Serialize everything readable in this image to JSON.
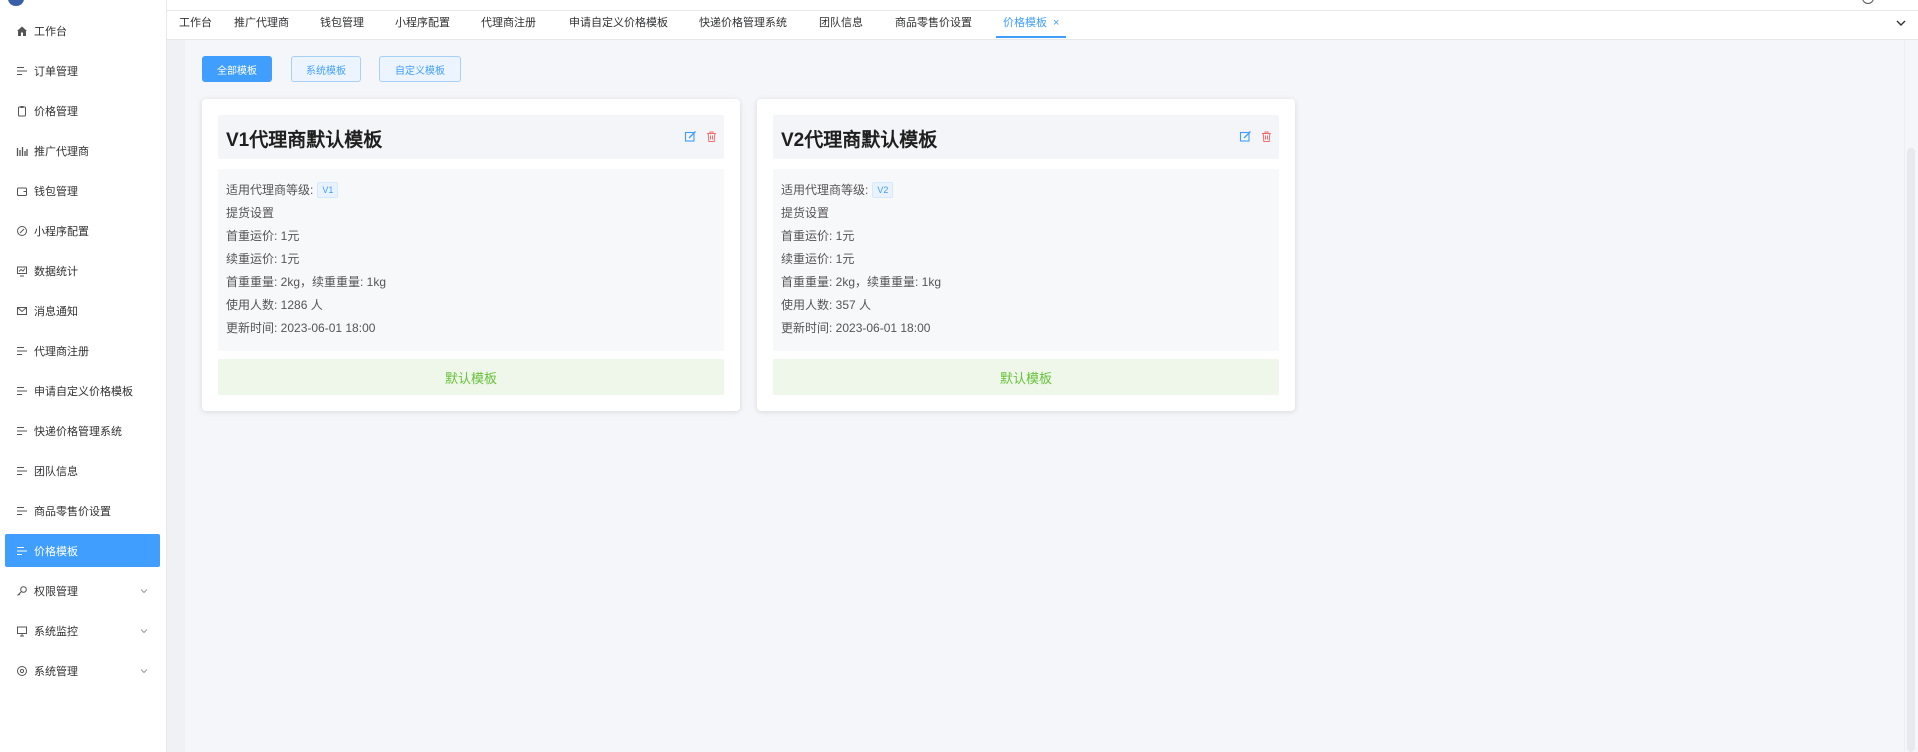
{
  "sidebar": {
    "items": [
      {
        "label": "工作台",
        "icon": "home-icon"
      },
      {
        "label": "订单管理",
        "icon": "list-icon"
      },
      {
        "label": "价格管理",
        "icon": "clipboard-icon"
      },
      {
        "label": "推广代理商",
        "icon": "bar-chart-icon"
      },
      {
        "label": "钱包管理",
        "icon": "wallet-icon"
      },
      {
        "label": "小程序配置",
        "icon": "compass-icon"
      },
      {
        "label": "数据统计",
        "icon": "chart-icon"
      },
      {
        "label": "消息通知",
        "icon": "mail-icon"
      },
      {
        "label": "代理商注册",
        "icon": "list-icon"
      },
      {
        "label": "申请自定义价格模板",
        "icon": "list-icon"
      },
      {
        "label": "快递价格管理系统",
        "icon": "list-icon"
      },
      {
        "label": "团队信息",
        "icon": "list-icon"
      },
      {
        "label": "商品零售价设置",
        "icon": "list-icon"
      },
      {
        "label": "价格模板",
        "icon": "list-icon",
        "active": true
      },
      {
        "label": "权限管理",
        "icon": "key-icon",
        "expandable": true
      },
      {
        "label": "系统监控",
        "icon": "monitor-icon",
        "expandable": true
      },
      {
        "label": "系统管理",
        "icon": "settings-icon",
        "expandable": true
      }
    ]
  },
  "tabs": [
    {
      "label": "工作台"
    },
    {
      "label": "推广代理商"
    },
    {
      "label": "钱包管理"
    },
    {
      "label": "小程序配置"
    },
    {
      "label": "代理商注册"
    },
    {
      "label": "申请自定义价格模板"
    },
    {
      "label": "快递价格管理系统"
    },
    {
      "label": "团队信息"
    },
    {
      "label": "商品零售价设置"
    },
    {
      "label": "价格模板",
      "active": true,
      "close": "×"
    }
  ],
  "filters": {
    "all": "全部模板",
    "system": "系统模板",
    "custom": "自定义模板"
  },
  "cards": [
    {
      "title": "V1代理商默认模板",
      "level_label": "适用代理商等级:",
      "level": "V1",
      "pickup": "提货设置",
      "first_price": "首重运价: 1元",
      "cont_price": "续重运价: 1元",
      "weights": "首重重量: 2kg，续重重量: 1kg",
      "users": "使用人数: 1286 人",
      "updated": "更新时间: 2023-06-01 18:00",
      "footer": "默认模板"
    },
    {
      "title": "V2代理商默认模板",
      "level_label": "适用代理商等级:",
      "level": "V2",
      "pickup": "提货设置",
      "first_price": "首重运价: 1元",
      "cont_price": "续重运价: 1元",
      "weights": "首重重量: 2kg，续重重量: 1kg",
      "users": "使用人数: 357 人",
      "updated": "更新时间: 2023-06-01 18:00",
      "footer": "默认模板"
    }
  ],
  "colors": {
    "primary": "#409eff",
    "success": "#67c23a",
    "danger": "#f56c6c"
  }
}
